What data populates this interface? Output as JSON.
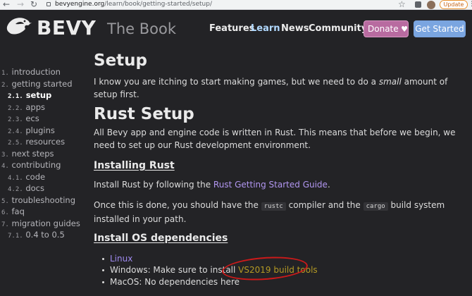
{
  "browser": {
    "url_host": "bevyengine.org",
    "url_path": "/learn/book/getting-started/setup/",
    "update_label": "Update",
    "back_icon": "arrow-left-icon",
    "forward_icon": "arrow-right-icon",
    "reload_icon": "reload-icon"
  },
  "header": {
    "brand": "BEVY",
    "book_title": "The Book",
    "nav": [
      "Features",
      "Learn",
      "News",
      "Community"
    ],
    "active_nav": "Learn",
    "donate_label": "Donate",
    "get_started_label": "Get Started"
  },
  "sidebar": {
    "items": [
      {
        "num": "1.",
        "label": "introduction",
        "level": 0,
        "current": false
      },
      {
        "num": "2.",
        "label": "getting started",
        "level": 0,
        "current": false
      },
      {
        "num": "2.1.",
        "label": "setup",
        "level": 1,
        "current": true
      },
      {
        "num": "2.2.",
        "label": "apps",
        "level": 1,
        "current": false
      },
      {
        "num": "2.3.",
        "label": "ecs",
        "level": 1,
        "current": false
      },
      {
        "num": "2.4.",
        "label": "plugins",
        "level": 1,
        "current": false
      },
      {
        "num": "2.5.",
        "label": "resources",
        "level": 1,
        "current": false
      },
      {
        "num": "3.",
        "label": "next steps",
        "level": 0,
        "current": false
      },
      {
        "num": "4.",
        "label": "contributing",
        "level": 0,
        "current": false
      },
      {
        "num": "4.1.",
        "label": "code",
        "level": 1,
        "current": false
      },
      {
        "num": "4.2.",
        "label": "docs",
        "level": 1,
        "current": false
      },
      {
        "num": "5.",
        "label": "troubleshooting",
        "level": 0,
        "current": false
      },
      {
        "num": "6.",
        "label": "faq",
        "level": 0,
        "current": false
      },
      {
        "num": "7.",
        "label": "migration guides",
        "level": 0,
        "current": false
      },
      {
        "num": "7.1.",
        "label": "0.4 to 0.5",
        "level": 1,
        "current": false
      }
    ]
  },
  "content": {
    "title": "Setup",
    "intro_before": "I know you are itching to start making games, but we need to do a ",
    "intro_em": "small",
    "intro_after": " amount of setup first.",
    "rust_setup_title": "Rust Setup",
    "rust_setup_text": "All Bevy app and engine code is written in Rust. This means that before we begin, we need to set up our Rust development environment.",
    "installing_rust_title": "Installing Rust",
    "install_before": "Install Rust by following the ",
    "install_link": "Rust Getting Started Guide",
    "install_after": ".",
    "once_before": "Once this is done, you should have the ",
    "code_rustc": "rustc",
    "once_mid": " compiler and the ",
    "code_cargo": "cargo",
    "once_after": " build system installed in your path.",
    "os_deps_title": "Install OS dependencies",
    "linux_link": "Linux",
    "windows_text": "Windows: Make sure to install ",
    "windows_link": "VS2019 build tools",
    "macos_text": "MacOS: No dependencies here"
  },
  "colors": {
    "background": "#232326",
    "link": "#b196f0",
    "donate": "#b86ba0",
    "get_started": "#7aa5e0",
    "annotation": "#cc1a1a"
  }
}
